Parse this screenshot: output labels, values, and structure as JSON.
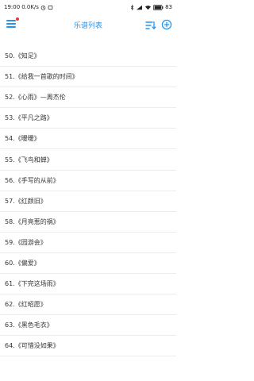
{
  "status": {
    "time": "19:00",
    "net_speed": "0.0K/s",
    "battery": "83"
  },
  "header": {
    "title": "乐谱列表"
  },
  "songs": [
    "50.《知足》",
    "51.《给我一首歌的时间》",
    "52.《心雨》—周杰伦",
    "53.《平凡之路》",
    "54.《暧暧》",
    "55.《飞鸟和蝉》",
    "56.《手写的从前》",
    "57.《红颜旧》",
    "58.《月亮惹的祸》",
    "59.《园游会》",
    "60.《偏爱》",
    "61.《下完这场雨》",
    "62.《红昭愿》",
    "63.《黑色毛衣》",
    "64.《可惜没如果》"
  ],
  "colors": {
    "accent": "#2196f3",
    "badge": "#e53935"
  },
  "icons": [
    "menu-icon",
    "sort-icon",
    "add-icon"
  ]
}
